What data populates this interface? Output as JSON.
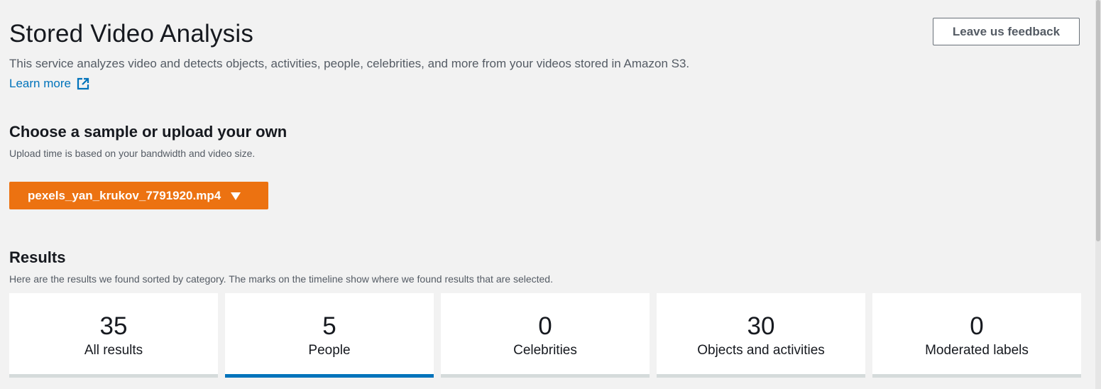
{
  "header": {
    "title": "Stored Video Analysis",
    "description": "This service analyzes video and detects objects, activities, people, celebrities, and more from your videos stored in Amazon S3.",
    "learn_more": "Learn more",
    "feedback_button": "Leave us feedback"
  },
  "sample": {
    "heading": "Choose a sample or upload your own",
    "subtext": "Upload time is based on your bandwidth and video size.",
    "selected_file": "pexels_yan_krukov_7791920.mp4"
  },
  "results": {
    "heading": "Results",
    "subtext": "Here are the results we found sorted by category. The marks on the timeline show where we found results that are selected.",
    "cards": [
      {
        "count": "35",
        "label": "All results",
        "selected": false
      },
      {
        "count": "5",
        "label": "People",
        "selected": true
      },
      {
        "count": "0",
        "label": "Celebrities",
        "selected": false
      },
      {
        "count": "30",
        "label": "Objects and activities",
        "selected": false
      },
      {
        "count": "0",
        "label": "Moderated labels",
        "selected": false
      }
    ]
  },
  "colors": {
    "accent_orange": "#ec7211",
    "link_blue": "#0073bb",
    "selected_underline": "#0073bb",
    "background": "#f2f2f2"
  },
  "icons": {
    "learn_more": "external-link-icon",
    "dropdown": "caret-down-icon"
  }
}
